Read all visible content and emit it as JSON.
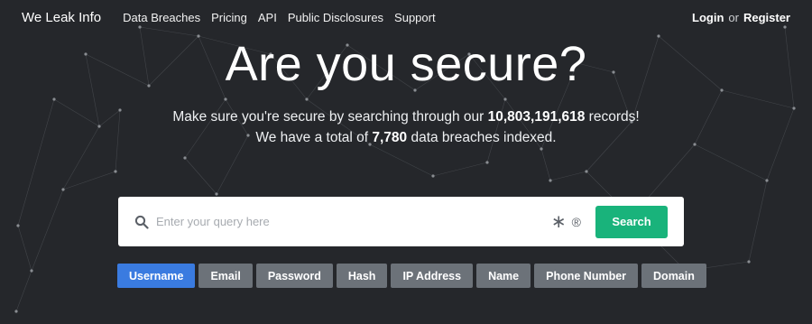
{
  "nav": {
    "brand": "We Leak Info",
    "links": [
      "Data Breaches",
      "Pricing",
      "API",
      "Public Disclosures",
      "Support"
    ],
    "login": "Login",
    "or": "or",
    "register": "Register"
  },
  "hero": {
    "title": "Are you secure?",
    "line1_prefix": "Make sure you're secure by searching through our ",
    "record_count": "10,803,191,618",
    "line1_suffix": " records!",
    "line2_prefix": "We have a total of ",
    "breach_count": "7,780",
    "line2_suffix": " data breaches indexed."
  },
  "search": {
    "placeholder": "Enter your query here",
    "wildcard_symbol": "∗",
    "regex_symbol": "®",
    "button_label": "Search"
  },
  "search_types": {
    "active_index": 0,
    "items": [
      "Username",
      "Email",
      "Password",
      "Hash",
      "IP Address",
      "Name",
      "Phone Number",
      "Domain"
    ]
  },
  "colors": {
    "background": "#25272b",
    "accent_green": "#19b37b",
    "active_tab": "#3a7be0",
    "tab": "#6c7279"
  }
}
